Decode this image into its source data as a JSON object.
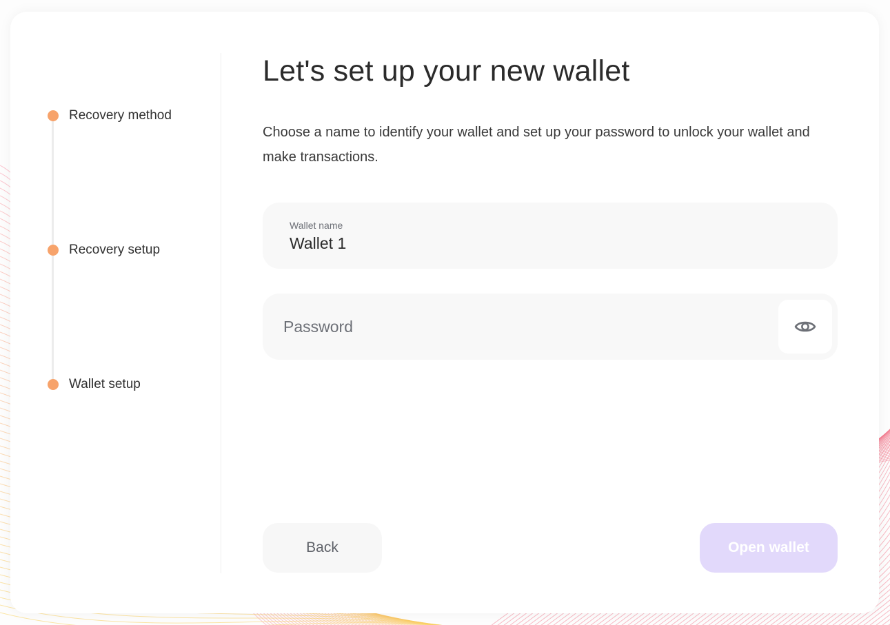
{
  "stepper": {
    "steps": [
      {
        "label": "Recovery method"
      },
      {
        "label": "Recovery setup"
      },
      {
        "label": "Wallet setup"
      }
    ]
  },
  "main": {
    "title": "Let's set up your new wallet",
    "subtitle": "Choose a name to identify your wallet and set up your password to unlock your wallet and make transactions."
  },
  "form": {
    "wallet_name_label": "Wallet name",
    "wallet_name_value": "Wallet 1",
    "password_placeholder": "Password",
    "password_toggle_icon": "eye-icon"
  },
  "actions": {
    "back_label": "Back",
    "open_wallet_label": "Open wallet"
  },
  "colors": {
    "step_dot": "#f7a36b",
    "primary_button_disabled": "#e2d9fb",
    "field_background": "#f8f8f8"
  }
}
